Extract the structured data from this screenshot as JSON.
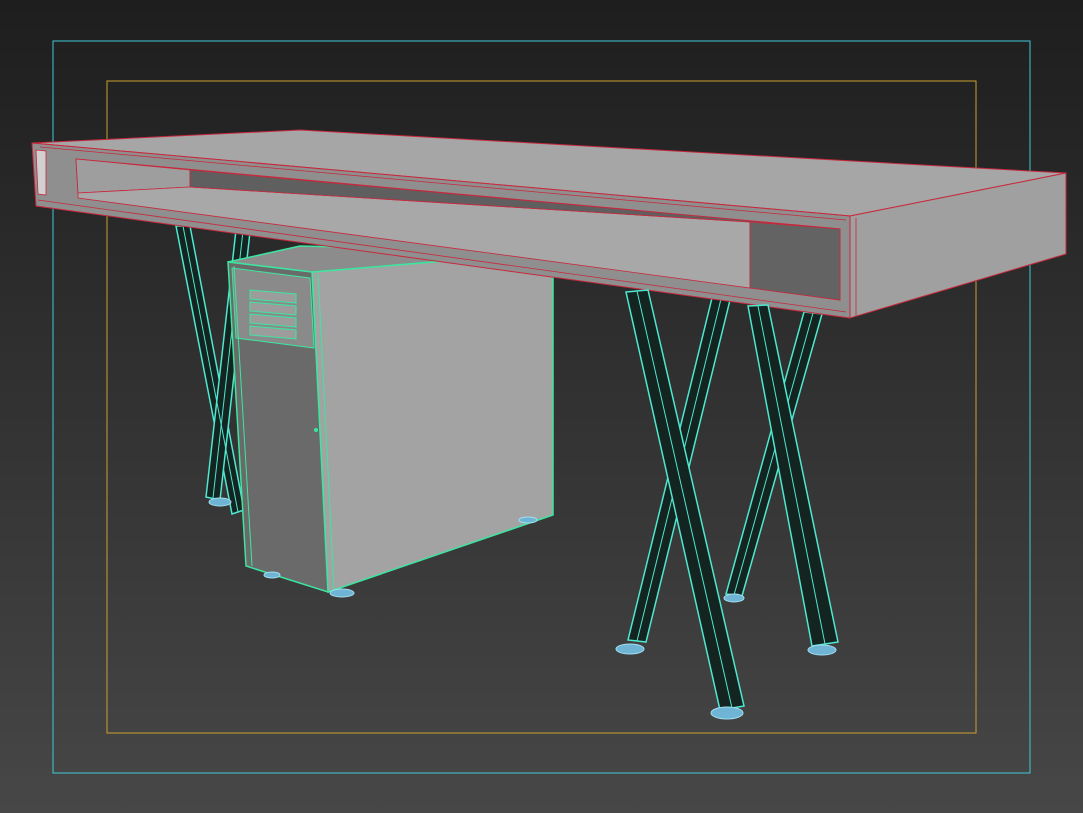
{
  "viewport": {
    "shading": "Edged Faces",
    "colors": {
      "background_top": "#1e1e1e",
      "background_bottom": "#474747",
      "outer_frame": "#3fc8d8",
      "safe_frame": "#c9a030",
      "desk_selection_edges": "#c8283c",
      "pc_selection_edges": "#3ce6a0",
      "leg_wireframe": "#4ee8d0",
      "desk_top_face": "#a6a6a6",
      "desk_front_face": "#8f8f8f",
      "desk_interior": "#6b6b6b",
      "pc_side_face": "#a3a3a3",
      "pc_front_face": "#6a6a6a",
      "leg_fill": "#142420",
      "foot_color": "#6fb4d4"
    }
  },
  "objects": [
    {
      "name": "desk-top",
      "type": "box"
    },
    {
      "name": "desk-legs",
      "type": "crossed-legs",
      "count": 8
    },
    {
      "name": "pc-tower",
      "type": "box"
    }
  ]
}
